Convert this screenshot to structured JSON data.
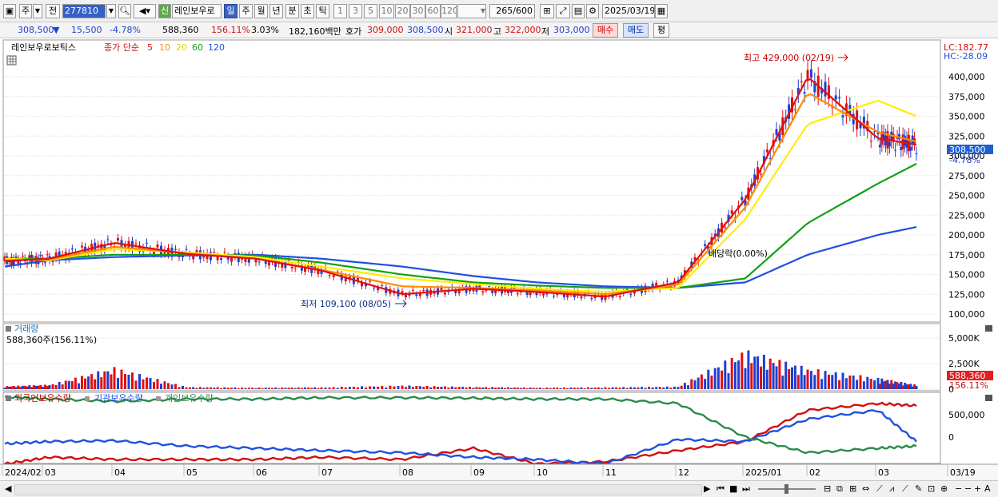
{
  "toolbar": {
    "type_label": "주",
    "prev_label": "전",
    "code_value": "277810",
    "new_badge": "신",
    "stock_name": "레인보우로",
    "period_tabs": [
      "일",
      "주",
      "월",
      "년",
      "분",
      "초",
      "틱"
    ],
    "selected_period": "일",
    "interval_buttons": [
      "1",
      "3",
      "5",
      "10",
      "20",
      "30",
      "60",
      "120"
    ],
    "count_value": "265",
    "count_total": "/600",
    "date_value": "2025/03/19"
  },
  "quote": {
    "price": "308,500",
    "change_arrow": "▼",
    "change": "15,500",
    "change_pct": "-4.78%",
    "volume": "588,360",
    "volume_ratio": "156.11%",
    "turnover_pct": "3.03%",
    "trade_value": "182,160백만",
    "ask_label": "호가",
    "ask": "309,000",
    "bid": "308,500",
    "open_label": "시",
    "open": "321,000",
    "high_label": "고",
    "high": "322,000",
    "low_label": "저",
    "low": "303,000",
    "buy_button": "매수",
    "sell_button": "매도",
    "eval_button": "평"
  },
  "price_panel": {
    "legend": {
      "name": "레인보우로보틱스",
      "type": "종가 단순",
      "periods": [
        "5",
        "10",
        "20",
        "60",
        "120"
      ]
    },
    "lc_label": "LC:182.77",
    "hc_label": "HC:-28.09",
    "current_price_tag": "308,500",
    "current_pct_tag": "-4.78%",
    "annot_high": "최고 429,000 (02/19)",
    "annot_low": "최저 109,100 (08/05)",
    "annot_dividend": "배당락(0.00%)"
  },
  "volume_panel": {
    "title": "거래량",
    "value_label": "588,360주(156.11%)",
    "axis_labels": [
      "5,000K",
      "2,500K",
      "0"
    ],
    "tag_value": "588,360",
    "tag_pct": "156.11%"
  },
  "holdings_panel": {
    "legend": [
      "외국인보유수량",
      "기관보유수량",
      "개인보유수량"
    ],
    "axis_labels": [
      "500,000",
      "0"
    ]
  },
  "x_axis": [
    "2024/02",
    "03",
    "04",
    "05",
    "06",
    "07",
    "08",
    "09",
    "10",
    "11",
    "12",
    "2025/01",
    "02",
    "03",
    "03/19"
  ],
  "chart_data": [
    {
      "type": "line",
      "title": "레인보우로보틱스",
      "x": [
        "2024/02",
        "03",
        "04",
        "05",
        "06",
        "07",
        "08",
        "09",
        "10",
        "11",
        "12",
        "2025/01",
        "02",
        "03",
        "03/19"
      ],
      "ylim": [
        100000,
        440000
      ],
      "y_ticks": [
        "100,000",
        "125,000",
        "150,000",
        "175,000",
        "200,000",
        "225,000",
        "250,000",
        "275,000",
        "300,000",
        "325,000",
        "350,000",
        "375,000",
        "400,000"
      ],
      "series": [
        {
          "name": "5",
          "color": "#e01010",
          "values": [
            167000,
            170000,
            190000,
            176000,
            170000,
            155000,
            125000,
            132000,
            128000,
            122000,
            140000,
            245000,
            400000,
            322000,
            314000
          ]
        },
        {
          "name": "10",
          "color": "#ff8c00",
          "values": [
            168000,
            169000,
            185000,
            177000,
            170000,
            156000,
            135000,
            133000,
            130000,
            125000,
            137000,
            235000,
            380000,
            330000,
            318000
          ]
        },
        {
          "name": "20",
          "color": "#ffee00",
          "values": [
            170000,
            168000,
            182000,
            178000,
            172000,
            160000,
            145000,
            138000,
            132000,
            128000,
            133000,
            220000,
            340000,
            370000,
            350000
          ]
        },
        {
          "name": "60",
          "color": "#12a012",
          "values": [
            170000,
            170000,
            175000,
            175000,
            174000,
            165000,
            150000,
            140000,
            136000,
            133000,
            133000,
            145000,
            215000,
            265000,
            290000
          ]
        },
        {
          "name": "120",
          "color": "#2050e0",
          "values": [
            160000,
            168000,
            172000,
            174000,
            175000,
            170000,
            160000,
            148000,
            140000,
            135000,
            133000,
            140000,
            175000,
            200000,
            210000
          ]
        }
      ]
    },
    {
      "type": "bar",
      "title": "거래량",
      "x": [
        "2024/02",
        "03",
        "04",
        "05",
        "06",
        "07",
        "08",
        "09",
        "10",
        "11",
        "12",
        "2025/01",
        "02",
        "03",
        "03/19"
      ],
      "ylim": [
        0,
        5000000
      ],
      "values": [
        400000,
        600000,
        2900000,
        300000,
        200000,
        250000,
        500000,
        300000,
        200000,
        250000,
        350000,
        5200000,
        2800000,
        1500000,
        588360
      ]
    },
    {
      "type": "line",
      "title": "보유수량",
      "x": [
        "2024/02",
        "03",
        "04",
        "05",
        "06",
        "07",
        "08",
        "09",
        "10",
        "11",
        "12",
        "2025/01",
        "02",
        "03",
        "03/19"
      ],
      "series": [
        {
          "name": "외국인보유수량",
          "color": "#d01010",
          "values": [
            -600000,
            -450000,
            -500000,
            -500000,
            -500000,
            -450000,
            -500000,
            -250000,
            -600000,
            -550000,
            -300000,
            -100000,
            600000,
            750000,
            700000
          ]
        },
        {
          "name": "기관보유수량",
          "color": "#2050e0",
          "values": [
            -150000,
            -100000,
            -80000,
            -200000,
            -250000,
            -300000,
            -350000,
            -450000,
            -500000,
            -600000,
            -50000,
            -100000,
            400000,
            600000,
            -100000
          ]
        },
        {
          "name": "개인보유수량",
          "color": "#2c8a4a",
          "values": [
            900000,
            850000,
            800000,
            850000,
            850000,
            880000,
            880000,
            870000,
            850000,
            850000,
            750000,
            0,
            -350000,
            -250000,
            -200000
          ]
        }
      ]
    }
  ]
}
